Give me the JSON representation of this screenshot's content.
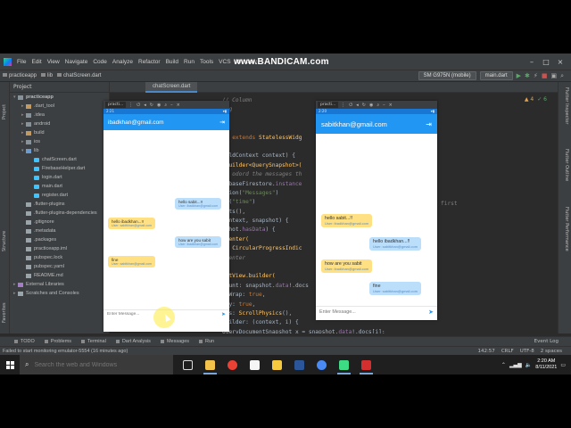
{
  "watermark": "www.BANDICAM.com",
  "menu": [
    "File",
    "Edit",
    "View",
    "Navigate",
    "Code",
    "Analyze",
    "Refactor",
    "Build",
    "Run",
    "Tools",
    "VCS",
    "Window"
  ],
  "breadcrumbs": [
    "practiceapp",
    "lib",
    "chatScreen.dart"
  ],
  "toolbar": {
    "device": "SM G975N (mobile)",
    "run_config": "main.dart"
  },
  "project_panel": {
    "title": "Project",
    "items": [
      {
        "label": "practiceapp",
        "depth": 0,
        "icon": "folder-icon"
      },
      {
        "label": ".dart_tool",
        "depth": 1,
        "icon": "folder-orange-icon"
      },
      {
        "label": ".idea",
        "depth": 1,
        "icon": "folder-icon"
      },
      {
        "label": "android",
        "depth": 1,
        "icon": "folder-icon"
      },
      {
        "label": "build",
        "depth": 1,
        "icon": "folder-orange-icon"
      },
      {
        "label": "ios",
        "depth": 1,
        "icon": "folder-icon"
      },
      {
        "label": "lib",
        "depth": 1,
        "icon": "folder-blue-icon"
      },
      {
        "label": "chatScreen.dart",
        "depth": 2,
        "icon": "dart-file-icon"
      },
      {
        "label": "FirebaseHelper.dart",
        "depth": 2,
        "icon": "dart-file-icon"
      },
      {
        "label": "login.dart",
        "depth": 2,
        "icon": "dart-file-icon"
      },
      {
        "label": "main.dart",
        "depth": 2,
        "icon": "dart-file-icon"
      },
      {
        "label": "register.dart",
        "depth": 2,
        "icon": "dart-file-icon"
      },
      {
        "label": ".flutter-plugins",
        "depth": 1,
        "icon": "file-icon"
      },
      {
        "label": ".flutter-plugins-dependencies",
        "depth": 1,
        "icon": "file-icon"
      },
      {
        "label": ".gitignore",
        "depth": 1,
        "icon": "file-icon"
      },
      {
        "label": ".metadata",
        "depth": 1,
        "icon": "file-icon"
      },
      {
        "label": ".packages",
        "depth": 1,
        "icon": "file-icon"
      },
      {
        "label": "practiceapp.iml",
        "depth": 1,
        "icon": "file-icon"
      },
      {
        "label": "pubspec.lock",
        "depth": 1,
        "icon": "file-icon"
      },
      {
        "label": "pubspec.yaml",
        "depth": 1,
        "icon": "file-icon"
      },
      {
        "label": "README.md",
        "depth": 1,
        "icon": "file-icon"
      },
      {
        "label": "External Libraries",
        "depth": 0,
        "icon": "library-icon"
      },
      {
        "label": "Scratches and Consoles",
        "depth": 0,
        "icon": "scratch-icon"
      }
    ]
  },
  "editor": {
    "tab": "chatScreen.dart",
    "warnings": "4",
    "checks": "6",
    "code_lines": [
      [
        {
          "t": "// Column",
          "c": "cm"
        }
      ],
      [
        {
          "t": "log",
          "c": "cm"
        }
      ],
      [
        {
          "t": "",
          "c": ""
        }
      ],
      [
        {
          "t": "",
          "c": ""
        }
      ],
      [
        {
          "t": "es ",
          "c": ""
        },
        {
          "t": "extends ",
          "c": "kw"
        },
        {
          "t": "StatelessWidg",
          "c": "cls"
        }
      ],
      [
        {
          "t": "",
          "c": ""
        }
      ],
      [
        {
          "t": "uildContext context) {",
          "c": ""
        }
      ],
      [
        {
          "t": "mBuilder<QuerySnapshot>(",
          "c": "cls"
        }
      ],
      [
        {
          "t": "an odord the messages th",
          "c": "cm"
        }
      ],
      [
        {
          "t": "rebaseFirestore.",
          "c": ""
        },
        {
          "t": "instance",
          "c": "fld"
        }
      ],
      [
        {
          "t": "ction(",
          "c": ""
        },
        {
          "t": "\"Messages\"",
          "c": "str"
        },
        {
          "t": ")",
          "c": ""
        }
      ],
      [
        {
          "t": "By(",
          "c": ""
        },
        {
          "t": "\"time\"",
          "c": "str"
        },
        {
          "t": ")",
          "c": ""
        }
      ],
      [
        {
          "t": "hots(),",
          "c": ""
        }
      ],
      [
        {
          "t": "context, snapshot) {",
          "c": ""
        }
      ],
      [
        {
          "t": "pshot.",
          "c": ""
        },
        {
          "t": "hasData",
          "c": "fld"
        },
        {
          "t": ") {",
          "c": ""
        }
      ],
      [
        {
          "t": " Center(",
          "c": "cls"
        }
      ],
      [
        {
          "t": "d: ",
          "c": ""
        },
        {
          "t": "CircularProgressIndic",
          "c": "cls"
        }
      ],
      [
        {
          "t": " Center",
          "c": "cm"
        }
      ],
      [
        {
          "t": "",
          "c": ""
        }
      ],
      [
        {
          "t": "istView.builder(",
          "c": "cls"
        }
      ],
      [
        {
          "t": "Count: snapshot.",
          "c": ""
        },
        {
          "t": "data",
          "c": "fld"
        },
        {
          "t": "!.docs",
          "c": ""
        }
      ],
      [
        {
          "t": "nkWrap: ",
          "c": ""
        },
        {
          "t": "true",
          "c": "kw"
        },
        {
          "t": ",",
          "c": ""
        }
      ],
      [
        {
          "t": "ary: ",
          "c": ""
        },
        {
          "t": "true",
          "c": "kw"
        },
        {
          "t": ",",
          "c": ""
        }
      ],
      [
        {
          "t": "ics: ",
          "c": ""
        },
        {
          "t": "ScrollPhysics",
          "c": "cls"
        },
        {
          "t": "(),",
          "c": ""
        }
      ],
      [
        {
          "t": "Builder: (context, i) {",
          "c": ""
        }
      ],
      [
        {
          "t": "QueryDocumentSnapshot x = snapshot.",
          "c": ""
        },
        {
          "t": "data",
          "c": "fld"
        },
        {
          "t": "!.docs[i];",
          "c": ""
        }
      ]
    ],
    "side_word": "first"
  },
  "right_tools": [
    "Flutter Inspector",
    "Flutter Outline",
    "Flutter Performance"
  ],
  "left_tools": [
    "Project",
    "Structure",
    "Favorites"
  ],
  "bottom_tools": [
    "TODO",
    "Problems",
    "Terminal",
    "Dart Analysis",
    "Messages",
    "Run"
  ],
  "event_log": "Event Log",
  "status": {
    "message": "Failed to start monitoring emulator-5554 (16 minutes ago)",
    "position": "142:57",
    "line_sep": "CRLF",
    "encoding": "UTF-8",
    "indent": "2 spaces"
  },
  "emulator_left": {
    "chip": "practi...",
    "email": "ibadkhan@gmail.com",
    "time": "2:21",
    "messages": [
      {
        "text": "hello sabit...!!",
        "user": "User: ibadkhan@gmail.com",
        "side": "right"
      },
      {
        "text": "hello ibadkhan...!!",
        "user": "User: sabitkhan@gmail.com",
        "side": "left"
      },
      {
        "text": "how are you sabit",
        "user": "User: ibadkhan@gmail.com",
        "side": "right"
      },
      {
        "text": "fine",
        "user": "User: sabitkhan@gmail.com",
        "side": "left"
      }
    ],
    "input_placeholder": "Enter Message..."
  },
  "emulator_right": {
    "chip": "practi...",
    "email": "sabitkhan@gmail.com",
    "time": "2:20",
    "messages": [
      {
        "text": "hello sabit...!!",
        "user": "User: ibadkhan@gmail.com",
        "side": "left"
      },
      {
        "text": "hello ibadkhan...!!",
        "user": "User: sabitkhan@gmail.com",
        "side": "right"
      },
      {
        "text": "how are you sabit",
        "user": "User: ibadkhan@gmail.com",
        "side": "left"
      },
      {
        "text": "fine",
        "user": "User: sabitkhan@gmail.com",
        "side": "right"
      }
    ],
    "input_placeholder": "Enter Message..."
  },
  "taskbar": {
    "search_placeholder": "Search the web and Windows",
    "apps": [
      {
        "name": "task-view-icon",
        "color": "#1f1f1f"
      },
      {
        "name": "file-explorer-icon",
        "color": "#f2c24b"
      },
      {
        "name": "chrome-icon",
        "color": "#e94235"
      },
      {
        "name": "media-icon",
        "color": "#f5f5f5"
      },
      {
        "name": "loom-icon",
        "color": "#f7c93e"
      },
      {
        "name": "word-icon",
        "color": "#2b579a"
      },
      {
        "name": "chrome-alt-icon",
        "color": "#4a8af4"
      },
      {
        "name": "android-studio-icon",
        "color": "#3ddc84"
      },
      {
        "name": "bandicam-icon",
        "color": "#d32f2f"
      }
    ],
    "time": "2:20 AM",
    "date": "8/11/2021"
  }
}
